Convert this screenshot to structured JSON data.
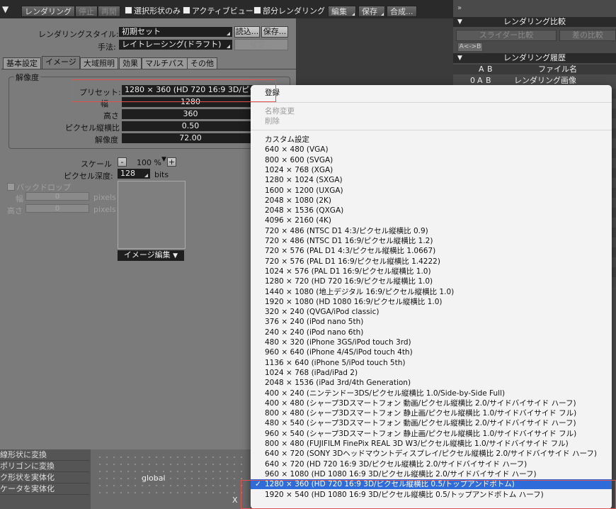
{
  "toolbar": {
    "collapse_arrow": "▼",
    "render": "レンダリング",
    "stop": "停止",
    "resume": "再開",
    "selected_only": "選択形状のみ",
    "active_view": "アクティブビュー",
    "partial_render": "部分レンダリング",
    "edit": "編集",
    "save": "保存",
    "composite": "合成...",
    "right_arrows": "»"
  },
  "panel": {
    "render_style_label": "レンダリングスタイル:",
    "render_style_value": "初期セット",
    "load_button": "読込...",
    "save_button": "保存...",
    "method_label": "手法:",
    "method_value": "レイトレーシング(ドラフト)",
    "settings_button": "設定...",
    "tabs": [
      "基本設定",
      "イメージ",
      "大域照明",
      "効果",
      "マルチパス",
      "その他"
    ],
    "resolution_group": "解像度",
    "preset_label": "プリセット:",
    "preset_value": "1280 × 360 (HD 720 16:9 3D/ピクセル",
    "width_label": "幅",
    "width_value": "1280",
    "height_label": "高さ",
    "height_value": "360",
    "pixel_aspect_label": "ピクセル縦横比",
    "pixel_aspect_value": "0.50",
    "resolution_label": "解像度",
    "resolution_value": "72.00",
    "scale_label": "スケール",
    "scale_minus": "-",
    "scale_value": "100 %",
    "scale_plus": "+",
    "pixel_depth_label": "ピクセル深度:",
    "pixel_depth_value": "128",
    "pixel_depth_unit": "bits",
    "backdrop_label": "バックドロップ",
    "bd_width_label": "幅",
    "bd_width_value": "0",
    "bd_height_label": "高さ",
    "bd_height_value": "0",
    "pixels_unit": "pixels",
    "image_edit_button": "イメージ編集"
  },
  "bottom_left": {
    "items": [
      "線形状に変換",
      "ポリゴンに変換",
      "ク形状を実体化",
      "ケータを実体化"
    ],
    "global_label": "global",
    "x_label": "X"
  },
  "right_panel": {
    "render_compare_header": "レンダリング比較",
    "slider_compare": "スライダー比較",
    "diff_compare": "差の比較",
    "ab_button": "A<->B",
    "render_history_header": "レンダリング履歴",
    "col_a": "A",
    "col_b": "B",
    "col_filename": "ファイル名",
    "row0_num": "0",
    "row0_a": "A",
    "row0_b": "B",
    "row0_name": "レンダリング画像"
  },
  "menu": {
    "register": "登録",
    "rename": "名称変更",
    "delete": "削除",
    "check_mark": "✓",
    "items": [
      "カスタム設定",
      "640 × 480 (VGA)",
      "800 × 600 (SVGA)",
      "1024 × 768 (XGA)",
      "1280 × 1024 (SXGA)",
      "1600 × 1200 (UXGA)",
      "2048 × 1080 (2K)",
      "2048 × 1536 (QXGA)",
      "4096 × 2160 (4K)",
      "720 × 486 (NTSC D1 4:3/ピクセル縦横比 0.9)",
      "720 × 486 (NTSC D1 16:9/ピクセル縦横比 1.2)",
      "720 × 576 (PAL D1 4:3/ピクセル縦横比 1.0667)",
      "720 × 576 (PAL D1 16:9/ピクセル縦横比 1.4222)",
      "1024 × 576 (PAL D1 16:9/ピクセル縦横比 1.0)",
      "1280 × 720 (HD 720 16:9/ピクセル縦横比 1.0)",
      "1440 × 1080 (地上デジタル 16:9/ピクセル縦横比 1.0)",
      "1920 × 1080 (HD 1080 16:9/ピクセル縦横比 1.0)",
      "320 × 240 (QVGA/iPod classic)",
      "376 × 240 (iPod nano 5th)",
      "240 × 240 (iPod nano 6th)",
      "480 × 320 (iPhone 3GS/iPod touch 3rd)",
      "960 × 640 (iPhone 4/4S/iPod touch 4th)",
      "1136 × 640 (iPhone 5/iPod touch 5th)",
      "1024 × 768 (iPad/iPad 2)",
      "2048 × 1536 (iPad 3rd/4th Generation)",
      "400 × 240 (ニンテンドー3DS/ピクセル縦横比 1.0/Side-by-Side Full)",
      "400 × 480 (シャープ3Dスマートフォン 動画/ピクセル縦横比 2.0/サイドバイサイド ハーフ)",
      "800 × 480 (シャープ3Dスマートフォン 静止画/ピクセル縦横比 1.0/サイドバイサイド フル)",
      "480 × 540 (シャープ3Dスマートフォン 動画/ピクセル縦横比 2.0/サイドバイサイド ハーフ)",
      "960 × 540 (シャープ3Dスマートフォン 静止画/ピクセル縦横比 1.0/サイドバイサイド フル)",
      "800 × 480 (FUJIFILM FinePix REAL 3D W3/ピクセル縦横比 1.0/サイドバイサイド フル)",
      "640 × 720 (SONY 3Dヘッドマウントディスプレイ/ピクセル縦横比 2.0/サイドバイサイド ハーフ)",
      "640 × 720 (HD 720 16:9 3D/ピクセル縦横比 2.0/サイドバイサイド ハーフ)",
      "960 × 1080 (HD 1080 16:9 3D/ピクセル縦横比 2.0/サイドバイサイド ハーフ)",
      "1280 × 360 (HD 720 16:9 3D/ピクセル縦横比 0.5/トップアンドボトム)",
      "1920 × 540 (HD 1080 16:9 3D/ピクセル縦横比 0.5/トップアンドボトム ハーフ)"
    ]
  }
}
